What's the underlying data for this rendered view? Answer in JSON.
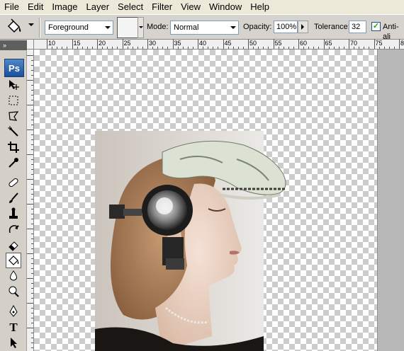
{
  "menu": [
    "File",
    "Edit",
    "Image",
    "Layer",
    "Select",
    "Filter",
    "View",
    "Window",
    "Help"
  ],
  "options": {
    "fill_source": "Foreground",
    "mode_label": "Mode:",
    "mode_value": "Normal",
    "opacity_label": "Opacity:",
    "opacity_value": "100%",
    "tolerance_label": "Tolerance:",
    "tolerance_value": "32",
    "anti_alias_label": "Anti-ali",
    "anti_alias_checked": true
  },
  "toolbox": {
    "grip": "»",
    "logo": "Ps",
    "tools": [
      "move-icon",
      "marquee-icon",
      "lasso-icon",
      "magic-wand-icon",
      "crop-icon",
      "eyedropper-icon",
      "healing-brush-icon",
      "brush-icon",
      "clone-stamp-icon",
      "history-brush-icon",
      "eraser-icon",
      "paint-bucket-icon",
      "blur-icon",
      "dodge-icon",
      "pen-icon",
      "type-icon",
      "path-selection-icon"
    ],
    "active_tool": "paint-bucket-icon"
  },
  "ruler": {
    "h_labels": [
      "10",
      "15",
      "20",
      "25",
      "30",
      "35",
      "40",
      "45",
      "50",
      "55",
      "60",
      "65",
      "70",
      "75",
      "80",
      "85"
    ]
  },
  "colors": {
    "menu_bg": "#ece9d8",
    "panel_bg": "#d4d0c8",
    "ps_blue": "#1c4f9c"
  }
}
